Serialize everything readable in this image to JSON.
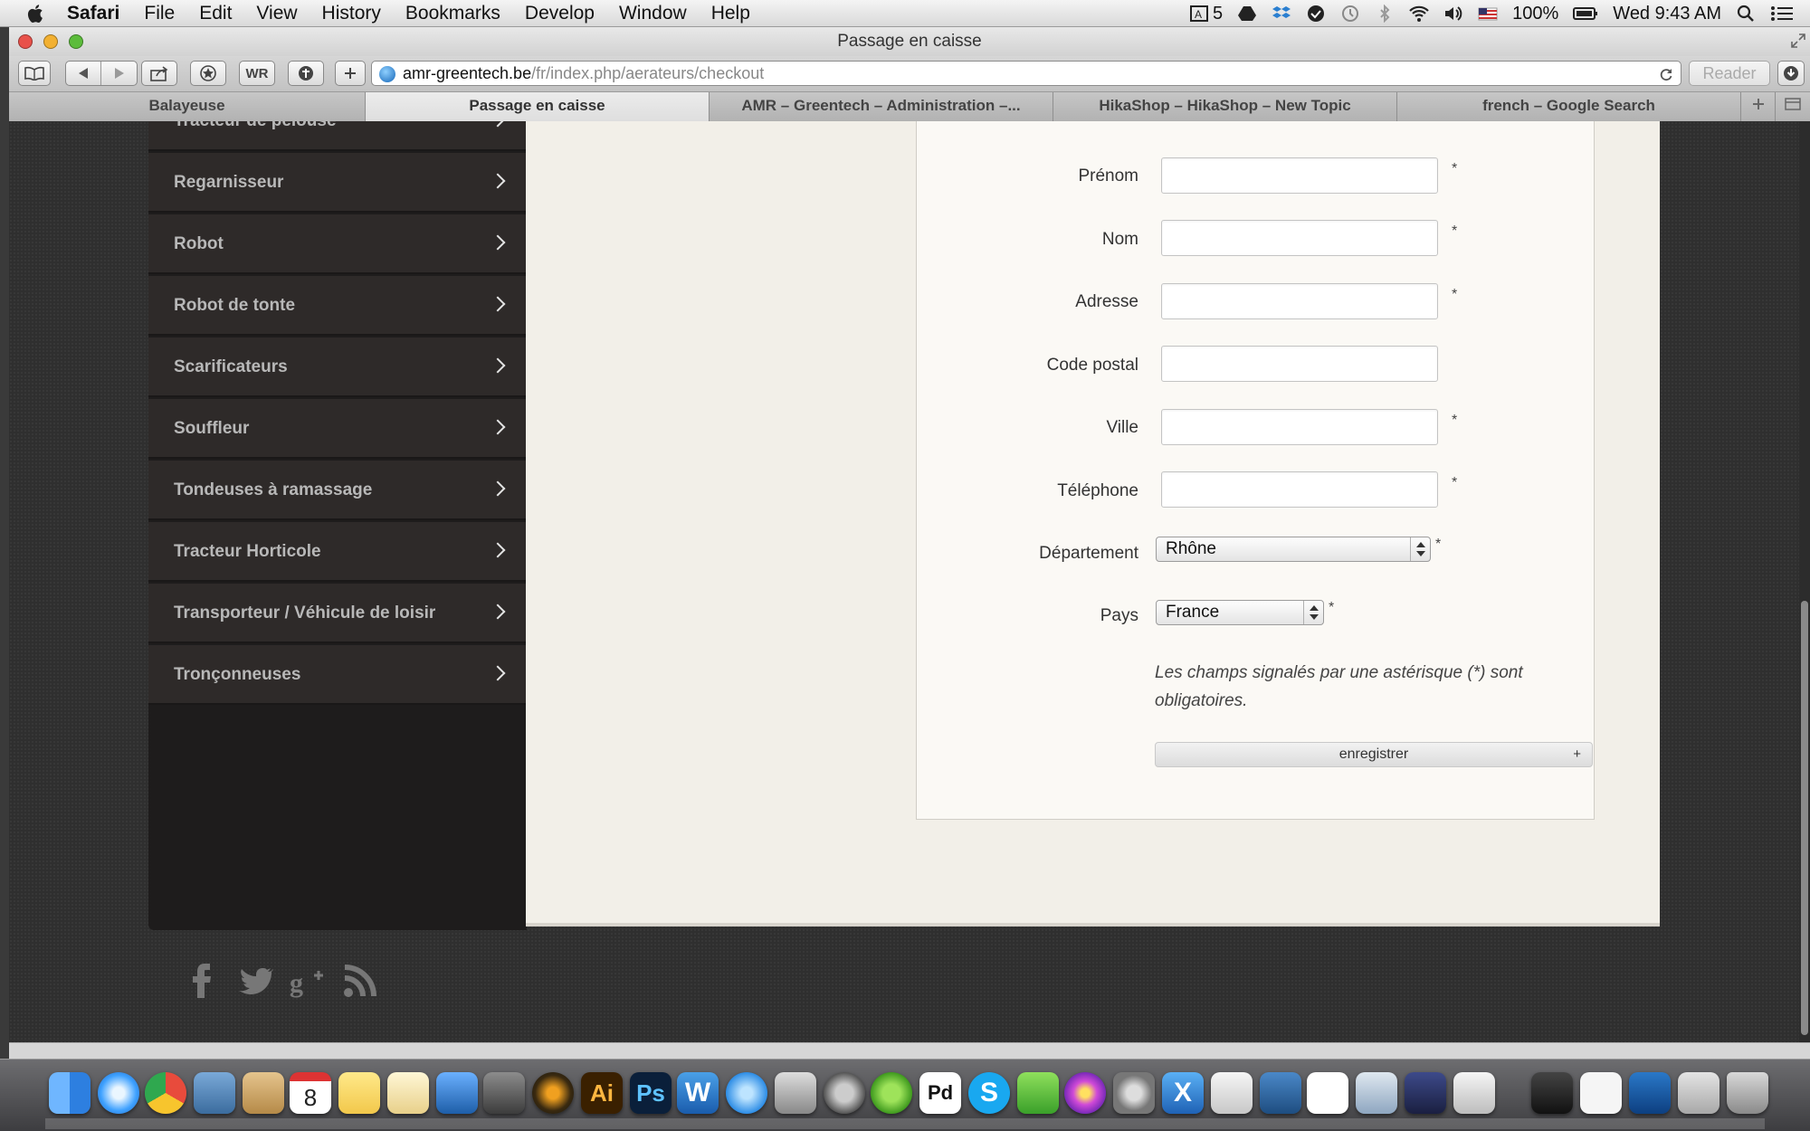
{
  "menubar": {
    "app": "Safari",
    "items": [
      "File",
      "Edit",
      "View",
      "History",
      "Bookmarks",
      "Develop",
      "Window",
      "Help"
    ],
    "status": {
      "ai_badge": "5",
      "battery": "100%",
      "clock": "Wed 9:43 AM"
    }
  },
  "window": {
    "title": "Passage en caisse"
  },
  "toolbar": {
    "wr_label": "WR",
    "url_host": "amr-greentech.be",
    "url_path": "/fr/index.php/aerateurs/checkout",
    "reader_label": "Reader"
  },
  "tabs": [
    {
      "label": "Balayeuse"
    },
    {
      "label": "Passage en caisse"
    },
    {
      "label": "AMR – Greentech – Administration –..."
    },
    {
      "label": "HikaShop – HikaShop – New Topic"
    },
    {
      "label": "french – Google Search"
    }
  ],
  "sidebar": {
    "items": [
      {
        "label": "Tracteur de pelouse"
      },
      {
        "label": "Regarnisseur"
      },
      {
        "label": "Robot"
      },
      {
        "label": "Robot de tonte"
      },
      {
        "label": "Scarificateurs"
      },
      {
        "label": "Souffleur"
      },
      {
        "label": "Tondeuses à ramassage"
      },
      {
        "label": "Tracteur Horticole"
      },
      {
        "label": "Transporteur / Véhicule de loisir"
      },
      {
        "label": "Tronçonneuses"
      }
    ]
  },
  "form": {
    "fields": [
      {
        "label": "Prénom",
        "value": "",
        "required": "*"
      },
      {
        "label": "Nom",
        "value": "",
        "required": "*"
      },
      {
        "label": "Adresse",
        "value": "",
        "required": "*"
      },
      {
        "label": "Code postal",
        "value": "",
        "required": ""
      },
      {
        "label": "Ville",
        "value": "",
        "required": "*"
      },
      {
        "label": "Téléphone",
        "value": "",
        "required": "*"
      }
    ],
    "departement": {
      "label": "Département",
      "value": "Rhône",
      "required": "*"
    },
    "pays": {
      "label": "Pays",
      "value": "France",
      "required": "*"
    },
    "note": "Les champs signalés par une astérisque (*) sont obligatoires.",
    "save_label": "enregistrer",
    "save_plus": "+"
  },
  "dock": {
    "calendar_day": "8"
  }
}
